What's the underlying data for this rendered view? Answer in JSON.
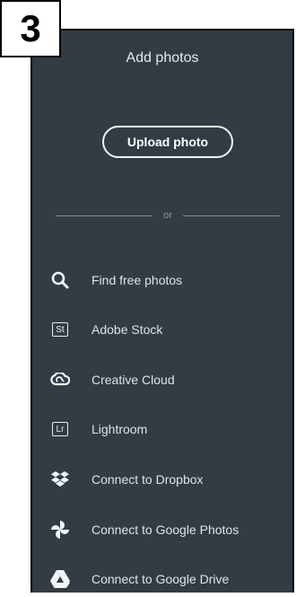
{
  "step_badge": "3",
  "panel": {
    "title": "Add photos",
    "upload_button": "Upload photo",
    "divider_text": "or"
  },
  "sources": [
    {
      "label": "Find free photos",
      "icon": "search-icon"
    },
    {
      "label": "Adobe Stock",
      "icon": "adobe-stock-icon",
      "icon_text": "St"
    },
    {
      "label": "Creative Cloud",
      "icon": "creative-cloud-icon"
    },
    {
      "label": "Lightroom",
      "icon": "lightroom-icon",
      "icon_text": "Lr"
    },
    {
      "label": "Connect to Dropbox",
      "icon": "dropbox-icon"
    },
    {
      "label": "Connect to Google Photos",
      "icon": "google-photos-icon"
    },
    {
      "label": "Connect to Google Drive",
      "icon": "google-drive-icon"
    }
  ],
  "colors": {
    "panel_bg": "#323c44",
    "text": "#dfe3e6",
    "divider": "#7f8a92"
  }
}
